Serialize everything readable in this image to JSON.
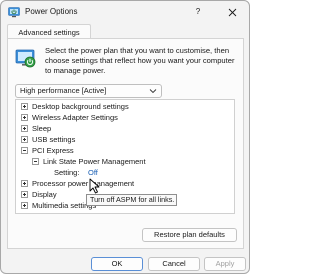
{
  "window": {
    "title": "Power Options",
    "help_label": "?",
    "close_icon": "close-icon"
  },
  "tab": {
    "label": "Advanced settings"
  },
  "description": "Select the power plan that you want to customise, then choose settings that reflect how you want your computer to manage power.",
  "plan_select": {
    "value": "High performance [Active]"
  },
  "tree": {
    "items": [
      {
        "label": "Desktop background settings",
        "expander": "plus"
      },
      {
        "label": "Wireless Adapter Settings",
        "expander": "plus"
      },
      {
        "label": "Sleep",
        "expander": "plus"
      },
      {
        "label": "USB settings",
        "expander": "plus"
      },
      {
        "label": "PCI Express",
        "expander": "minus"
      },
      {
        "label": "Link State Power Management",
        "expander": "minus"
      },
      {
        "label": "Setting:",
        "value": "Off"
      },
      {
        "label": "Processor power management",
        "expander": "plus"
      },
      {
        "label": "Display",
        "expander": "plus"
      },
      {
        "label": "Multimedia settings",
        "expander": "plus"
      }
    ]
  },
  "tooltip": "Turn off ASPM for all links.",
  "buttons": {
    "restore": "Restore plan defaults",
    "ok": "OK",
    "cancel": "Cancel",
    "apply": "Apply"
  },
  "colors": {
    "accent": "#1a5fb4",
    "ok_border": "#5a8fd6"
  }
}
